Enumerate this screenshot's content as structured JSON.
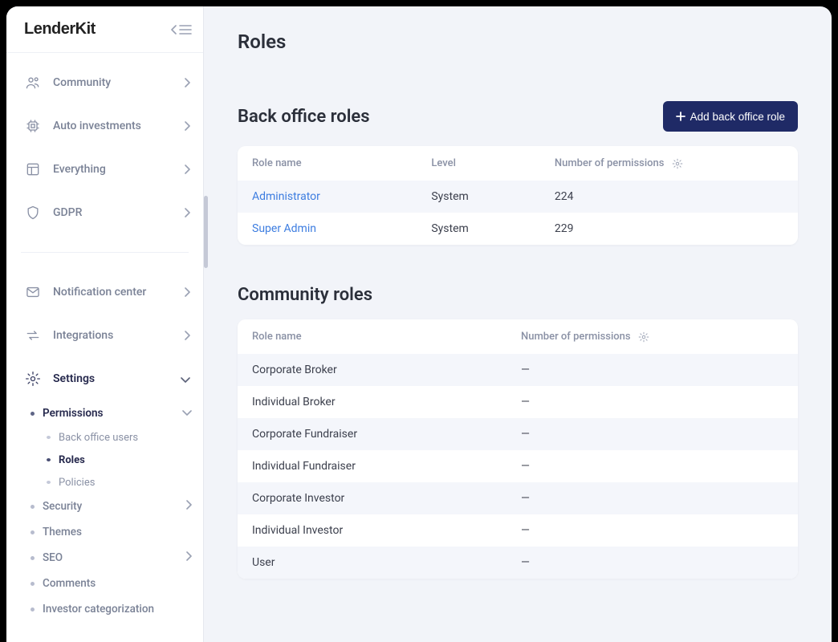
{
  "brand": "LenderKit",
  "sidebar": {
    "items": [
      {
        "label": "Community"
      },
      {
        "label": "Auto investments"
      },
      {
        "label": "Everything"
      },
      {
        "label": "GDPR"
      }
    ],
    "items2": [
      {
        "label": "Notification center"
      },
      {
        "label": "Integrations"
      }
    ],
    "settings_label": "Settings",
    "settings_children": {
      "permissions_label": "Permissions",
      "permissions_children": [
        {
          "label": "Back office users"
        },
        {
          "label": "Roles"
        },
        {
          "label": "Policies"
        }
      ],
      "rest": [
        {
          "label": "Security",
          "chevron": true
        },
        {
          "label": "Themes",
          "chevron": false
        },
        {
          "label": "SEO",
          "chevron": true
        },
        {
          "label": "Comments",
          "chevron": false
        },
        {
          "label": "Investor categorization",
          "chevron": false
        }
      ]
    }
  },
  "page": {
    "title": "Roles",
    "back_office": {
      "title": "Back office roles",
      "add_button": "Add back office role",
      "columns": {
        "c0": "Role name",
        "c1": "Level",
        "c2": "Number of permissions"
      },
      "rows": [
        {
          "name": "Administrator",
          "level": "System",
          "perm": "224"
        },
        {
          "name": "Super Admin",
          "level": "System",
          "perm": "229"
        }
      ]
    },
    "community": {
      "title": "Community roles",
      "columns": {
        "c0": "Role name",
        "c1": "Number of permissions"
      },
      "rows": [
        {
          "name": "Corporate Broker",
          "perm": "—"
        },
        {
          "name": "Individual Broker",
          "perm": "—"
        },
        {
          "name": "Corporate Fundraiser",
          "perm": "—"
        },
        {
          "name": "Individual Fundraiser",
          "perm": "—"
        },
        {
          "name": "Corporate Investor",
          "perm": "—"
        },
        {
          "name": "Individual Investor",
          "perm": "—"
        },
        {
          "name": "User",
          "perm": "—"
        }
      ]
    }
  }
}
